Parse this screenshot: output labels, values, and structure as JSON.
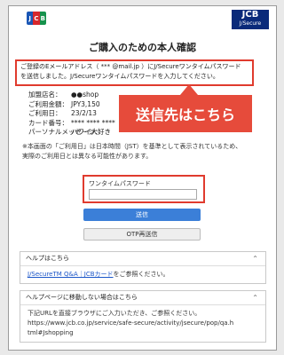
{
  "header": {
    "left_logo_letters": [
      "J",
      "C",
      "B"
    ],
    "left_logo_colors": [
      "#1a56b5",
      "#d7272c",
      "#16924c"
    ],
    "right_logo_line1": "JCB",
    "right_logo_line2": "J/Secure"
  },
  "page_title": "ご購入のための本人確認",
  "notice": {
    "line1": "ご登録のEメールアドレス（ *** @mail.jp ）にJ/Secureワンタイムパスワード",
    "line2": "を送信しました。J/Secureワンタイムパスワードを入力してください。"
  },
  "merchant": {
    "rows": [
      {
        "label": "加盟店名：",
        "value": "●●shop"
      },
      {
        "label": "ご利用金額：",
        "value": "JPY3,150"
      },
      {
        "label": "ご利用日：",
        "value": "23/2/13"
      },
      {
        "label": "カード番号：",
        "value": "**** **** ****"
      },
      {
        "label": "パーソナルメッセージ：",
        "value": "ハワイ大好き"
      }
    ]
  },
  "callout": {
    "text": "送信先はこちら"
  },
  "note": {
    "line1": "※本画面の「ご利用日」は日本時間（JST）を基準として表示されているため、",
    "line2": "実際のご利用日とは異なる可能性があります。"
  },
  "otp": {
    "label": "ワンタイムパスワード",
    "value": ""
  },
  "buttons": {
    "send": "送信",
    "resend": "OTP再送信"
  },
  "help_panel": {
    "title": "ヘルプはこちら",
    "link_text": "J/SecureTM Q&A｜JCBカード",
    "suffix": "をご参照ください。"
  },
  "help_page_panel": {
    "title": "ヘルプページに移動しない場合はこちら",
    "line1": "下記URLを直接ブラウザにご入力いただき、ご参照ください。",
    "line2": "https://www.jcb.co.jp/service/safe-secure/activity/jsecure/pop/qa.h",
    "line3": "tml#Jshopping"
  }
}
